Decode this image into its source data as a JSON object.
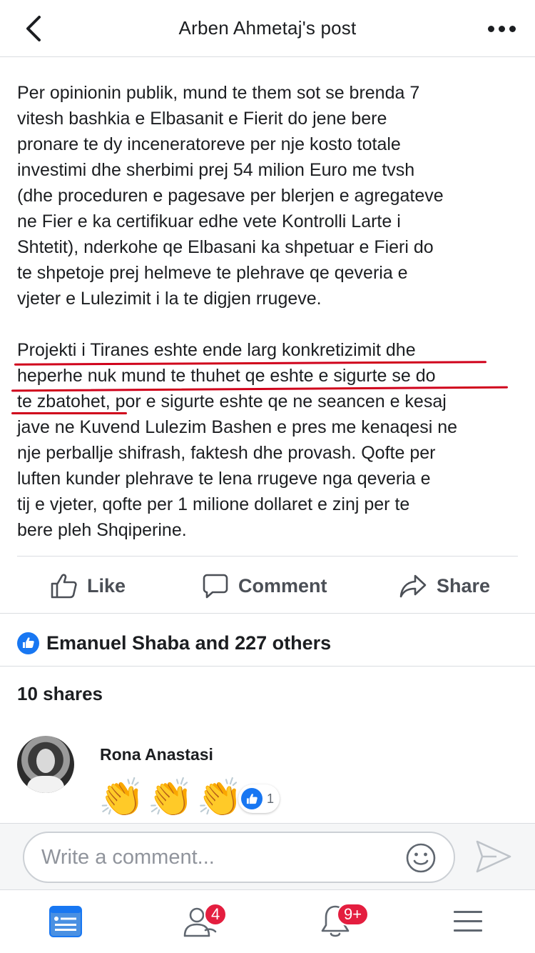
{
  "header": {
    "title": "Arben Ahmetaj's post"
  },
  "post": {
    "paragraphs": [
      "Per opinionin publik, mund te them sot se brenda 7\nvitesh bashkia e  Elbasanit  e Fierit do jene bere\npronare te dy inceneratoreve per nje kosto totale\ninvestimi dhe sherbimi prej 54 milion Euro me tvsh\n(dhe proceduren e pagesave per blerjen e agregateve\nne Fier e ka certifikuar edhe vete Kontrolli Larte i\nShtetit), nderkohe qe Elbasani ka shpetuar e Fieri do\nte shpetoje prej helmeve te plehrave qe qeveria e\nvjeter e Lulezimit i la te digjen rrugeve.",
      "Projekti i Tiranes eshte ende larg konkretizimit dhe\nheperhe nuk mund te thuhet qe eshte e sigurte se do\nte zbatohet, por e sigurte eshte qe ne seancen e kesaj\njave ne Kuvend Lulezim Bashen e pres me kenaqesi ne\nnje perballje shifrash, faktesh dhe provash. Qofte per\nluften kunder plehrave te lena rrugeve nga qeveria e\ntij e vjeter, qofte per 1 milione dollaret e zinj per te\nbere pleh Shqiperine."
    ],
    "annotation_color": "#d0021b"
  },
  "actions": {
    "like": "Like",
    "comment": "Comment",
    "share": "Share"
  },
  "reactions": {
    "summary": "Emanuel Shaba and 227 others",
    "shares": "10 shares"
  },
  "comment": {
    "author": "Rona Anastasi",
    "emoji": [
      "👏",
      "👏",
      "👏"
    ],
    "like_count": "1"
  },
  "composer": {
    "placeholder": "Write a comment..."
  },
  "tabbar": {
    "friends_badge": "4",
    "notifications_badge": "9+"
  },
  "colors": {
    "brand_blue": "#1877f2",
    "badge_red": "#e41e3f"
  }
}
